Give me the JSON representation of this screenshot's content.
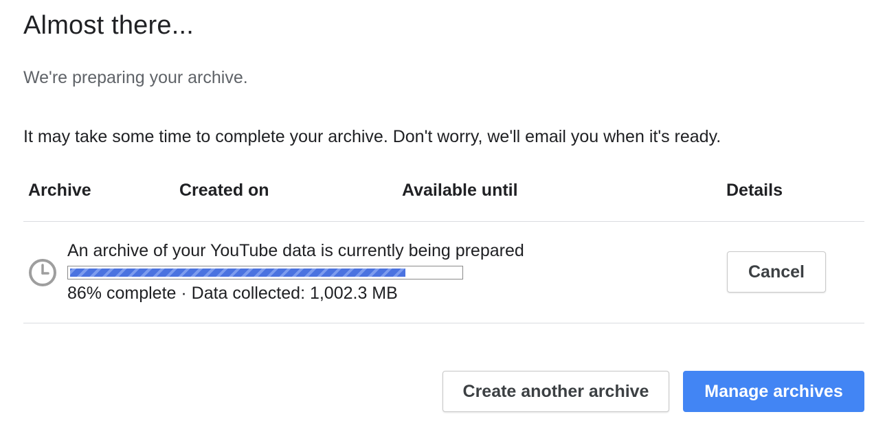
{
  "dialog": {
    "title": "Almost there...",
    "subtitle": "We're preparing your archive.",
    "description": "It may take some time to complete your archive. Don't worry, we'll email you when it's ready."
  },
  "table": {
    "headers": {
      "archive": "Archive",
      "created_on": "Created on",
      "available_until": "Available until",
      "details": "Details"
    },
    "row": {
      "icon": "clock-icon",
      "message": "An archive of your YouTube data is currently being prepared",
      "progress_fraction": 0.86,
      "progress_text": "86% complete · Data collected: 1,002.3 MB",
      "cancel_label": "Cancel"
    }
  },
  "actions": {
    "create_label": "Create another archive",
    "manage_label": "Manage archives"
  },
  "colors": {
    "accent": "#4285f4",
    "progress_fill": "#4b73e0",
    "progress_stripe": "#7d9cee",
    "divider": "#dadce0",
    "muted_text": "#5f6368"
  }
}
